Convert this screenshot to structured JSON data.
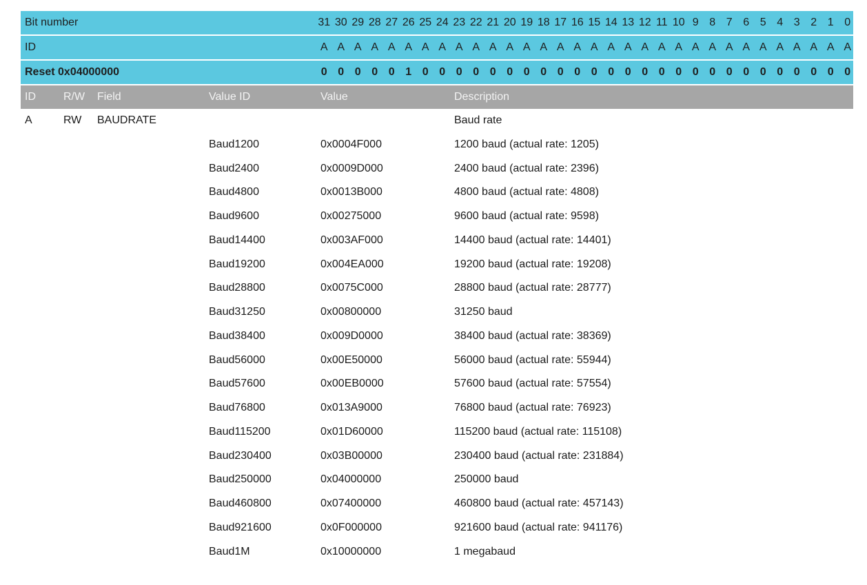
{
  "bit_number_label": "Bit number",
  "bit_numbers": [
    "31",
    "30",
    "29",
    "28",
    "27",
    "26",
    "25",
    "24",
    "23",
    "22",
    "21",
    "20",
    "19",
    "18",
    "17",
    "16",
    "15",
    "14",
    "13",
    "12",
    "11",
    "10",
    "9",
    "8",
    "7",
    "6",
    "5",
    "4",
    "3",
    "2",
    "1",
    "0"
  ],
  "id_label": "ID",
  "id_bits": [
    "A",
    "A",
    "A",
    "A",
    "A",
    "A",
    "A",
    "A",
    "A",
    "A",
    "A",
    "A",
    "A",
    "A",
    "A",
    "A",
    "A",
    "A",
    "A",
    "A",
    "A",
    "A",
    "A",
    "A",
    "A",
    "A",
    "A",
    "A",
    "A",
    "A",
    "A",
    "A"
  ],
  "reset_label": "Reset 0x04000000",
  "reset_bits": [
    "0",
    "0",
    "0",
    "0",
    "0",
    "1",
    "0",
    "0",
    "0",
    "0",
    "0",
    "0",
    "0",
    "0",
    "0",
    "0",
    "0",
    "0",
    "0",
    "0",
    "0",
    "0",
    "0",
    "0",
    "0",
    "0",
    "0",
    "0",
    "0",
    "0",
    "0",
    "0"
  ],
  "columns": {
    "id": "ID",
    "rw": "R/W",
    "field": "Field",
    "value_id": "Value ID",
    "value": "Value",
    "description": "Description"
  },
  "field": {
    "id": "A",
    "rw": "RW",
    "name": "BAUDRATE",
    "description": "Baud rate"
  },
  "values": [
    {
      "id": "Baud1200",
      "value": "0x0004F000",
      "description": "1200 baud (actual rate: 1205)"
    },
    {
      "id": "Baud2400",
      "value": "0x0009D000",
      "description": "2400 baud (actual rate: 2396)"
    },
    {
      "id": "Baud4800",
      "value": "0x0013B000",
      "description": "4800 baud (actual rate: 4808)"
    },
    {
      "id": "Baud9600",
      "value": "0x00275000",
      "description": "9600 baud (actual rate: 9598)"
    },
    {
      "id": "Baud14400",
      "value": "0x003AF000",
      "description": "14400 baud (actual rate: 14401)"
    },
    {
      "id": "Baud19200",
      "value": "0x004EA000",
      "description": "19200 baud (actual rate: 19208)"
    },
    {
      "id": "Baud28800",
      "value": "0x0075C000",
      "description": "28800 baud (actual rate: 28777)"
    },
    {
      "id": "Baud31250",
      "value": "0x00800000",
      "description": "31250 baud"
    },
    {
      "id": "Baud38400",
      "value": "0x009D0000",
      "description": "38400 baud (actual rate: 38369)"
    },
    {
      "id": "Baud56000",
      "value": "0x00E50000",
      "description": "56000 baud (actual rate: 55944)"
    },
    {
      "id": "Baud57600",
      "value": "0x00EB0000",
      "description": "57600 baud (actual rate: 57554)"
    },
    {
      "id": "Baud76800",
      "value": "0x013A9000",
      "description": "76800 baud (actual rate: 76923)"
    },
    {
      "id": "Baud115200",
      "value": "0x01D60000",
      "description": "115200 baud (actual rate: 115108)"
    },
    {
      "id": "Baud230400",
      "value": "0x03B00000",
      "description": "230400 baud (actual rate: 231884)"
    },
    {
      "id": "Baud250000",
      "value": "0x04000000",
      "description": "250000 baud"
    },
    {
      "id": "Baud460800",
      "value": "0x07400000",
      "description": "460800 baud (actual rate: 457143)"
    },
    {
      "id": "Baud921600",
      "value": "0x0F000000",
      "description": "921600 baud (actual rate: 941176)"
    },
    {
      "id": "Baud1M",
      "value": "0x10000000",
      "description": "1 megabaud"
    }
  ],
  "colors": {
    "header_bar": "#5bc8e0",
    "column_header": "#a6a6a6"
  }
}
